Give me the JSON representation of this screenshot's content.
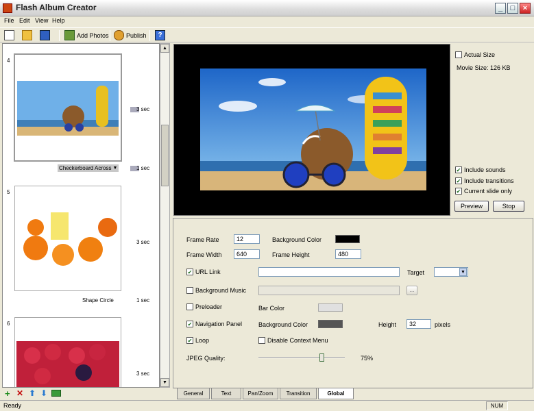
{
  "window": {
    "title": "Flash Album Creator"
  },
  "menu": [
    "File",
    "Edit",
    "View",
    "Help"
  ],
  "toolbar": {
    "add_photos": "Add Photos",
    "publish": "Publish"
  },
  "slides": [
    {
      "number": "4",
      "duration": "3 sec",
      "transition": "Checkerboard Across",
      "transition_duration": "1 sec"
    },
    {
      "number": "5",
      "duration": "3 sec",
      "transition": "Shape Circle",
      "transition_duration": "1 sec"
    },
    {
      "number": "6",
      "duration": "3 sec"
    }
  ],
  "preview_panel": {
    "actual_size": "Actual Size",
    "movie_size": "Movie Size:  126 KB",
    "include_sounds": "Include sounds",
    "include_transitions": "Include transitions",
    "current_slide_only": "Current slide only",
    "preview": "Preview",
    "stop": "Stop"
  },
  "settings": {
    "frame_rate_label": "Frame Rate",
    "frame_rate": "12",
    "background_color_label": "Background Color",
    "frame_width_label": "Frame Width",
    "frame_width": "640",
    "frame_height_label": "Frame Height",
    "frame_height": "480",
    "url_link": "URL Link",
    "target_label": "Target",
    "background_music": "Background Music",
    "browse": "...",
    "preloader": "Preloader",
    "bar_color_label": "Bar Color",
    "navigation_panel": "Navigation Panel",
    "nav_background_color_label": "Background Color",
    "height_label": "Height",
    "height_value": "32",
    "pixels": "pixels",
    "loop": "Loop",
    "disable_context_menu": "Disable Context Menu",
    "jpeg_quality_label": "JPEG Quality:",
    "jpeg_quality_value": "75%",
    "jpeg_quality_fraction": 0.75
  },
  "tabs": [
    "General",
    "Text",
    "Pan/Zoom",
    "Transition",
    "Global"
  ],
  "active_tab": "Global",
  "status": {
    "left": "Ready",
    "num": "NUM"
  },
  "colors": {
    "accent": "#316ac5",
    "background_color": "#000000",
    "nav_background_color": "#555555",
    "bar_color": "#e0e0e0"
  }
}
